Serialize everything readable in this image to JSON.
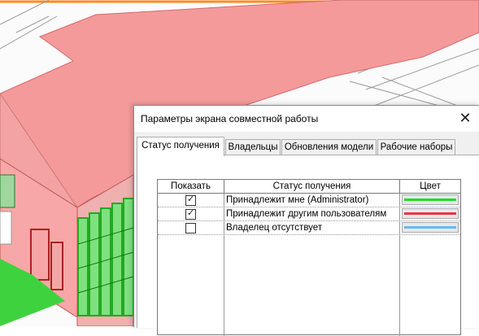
{
  "dialog": {
    "title": "Параметры экрана совместной работы",
    "close_glyph": "✕",
    "tabs": [
      {
        "label": "Статус получения",
        "active": true
      },
      {
        "label": "Владельцы",
        "active": false
      },
      {
        "label": "Обновления модели",
        "active": false
      },
      {
        "label": "Рабочие наборы",
        "active": false
      }
    ],
    "table": {
      "headers": [
        "Показать",
        "Статус получения",
        "Цвет"
      ],
      "rows": [
        {
          "show": true,
          "status": "Принадлежит мне (Administrator)",
          "color": "#22dd22"
        },
        {
          "show": true,
          "status": "Принадлежит другим пользователям",
          "color": "#ee3344"
        },
        {
          "show": false,
          "status": "Владелец отсутствует",
          "color": "#66bbee"
        }
      ]
    }
  },
  "icons": {
    "checkbox_check": "check-icon",
    "close": "close-icon"
  },
  "colors": {
    "roof_red": "#f59a9a",
    "glass_green": "#3fd23f",
    "accent_orange": "#ff6a00"
  }
}
